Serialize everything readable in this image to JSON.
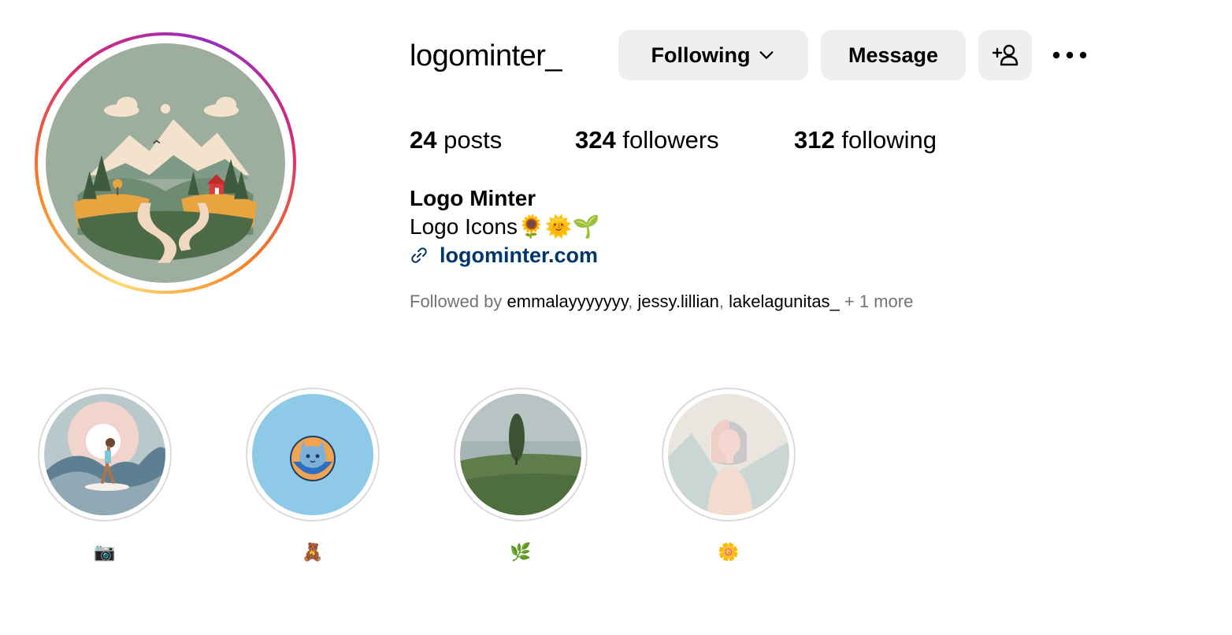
{
  "profile": {
    "username": "logominter_",
    "full_name": "Logo Minter",
    "bio": "Logo Icons🌻🌞🌱",
    "link": "logominter.com",
    "avatar_icon": "landscape-logo-avatar"
  },
  "actions": {
    "following_label": "Following",
    "message_label": "Message",
    "add_user_icon": "add-person-icon",
    "more_icon": "more-options-icon"
  },
  "stats": {
    "posts_count": "24",
    "posts_label": "posts",
    "followers_count": "324",
    "followers_label": "followers",
    "following_count": "312",
    "following_label": "following"
  },
  "followed_by": {
    "prefix": "Followed by ",
    "users": [
      "emmalayyyyyyy",
      "jessy.lillian",
      "lakelagunitas_"
    ],
    "separator": ", ",
    "suffix": " + 1 more"
  },
  "highlights": [
    {
      "label": "📷",
      "icon": "surfer-highlight"
    },
    {
      "label": "🧸",
      "icon": "cat-logo-highlight"
    },
    {
      "label": "🌿",
      "icon": "tree-field-highlight"
    },
    {
      "label": "🌼",
      "icon": "woman-portrait-highlight"
    }
  ],
  "colors": {
    "link": "#00376b",
    "button_bg": "#efefef",
    "muted_text": "#737373",
    "highlight_border": "#dbdbdb"
  }
}
